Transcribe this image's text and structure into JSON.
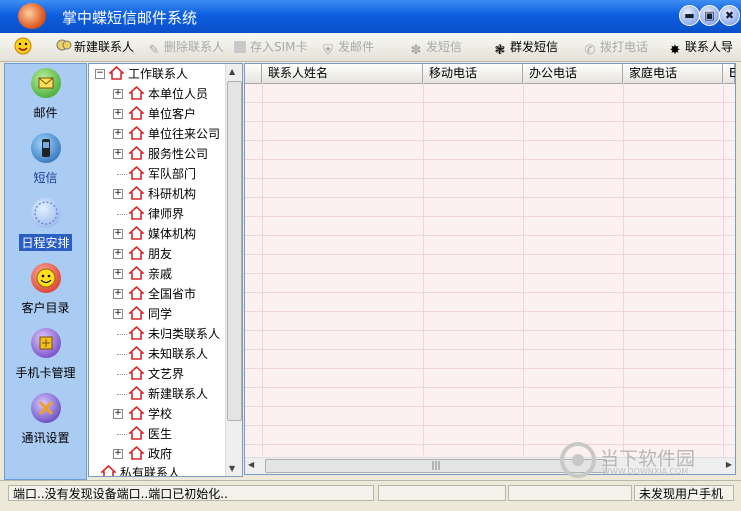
{
  "window": {
    "title": "掌中蝶短信邮件系统"
  },
  "title_buttons": {
    "minimize": "▬",
    "restore": "▣",
    "close": "✖"
  },
  "toolbar": {
    "new_contact": "新建联系人",
    "delete_contact": "删除联系人",
    "save_sim": "存入SIM卡",
    "send_mail": "发邮件",
    "send_sms": "发短信",
    "bulk_sms": "群发短信",
    "dial": "拨打电话",
    "contact_group": "联系人导"
  },
  "sidebar": {
    "items": [
      {
        "label": "邮件",
        "icon": "mail-icon",
        "selected": false
      },
      {
        "label": "短信",
        "icon": "phone-icon",
        "selected": false
      },
      {
        "label": "日程安排",
        "icon": "schedule-icon",
        "selected": true
      },
      {
        "label": "客户目录",
        "icon": "smiley-icon",
        "selected": false
      },
      {
        "label": "手机卡管理",
        "icon": "simcard-icon",
        "selected": false
      },
      {
        "label": "通讯设置",
        "icon": "tools-icon",
        "selected": false
      }
    ]
  },
  "tree": {
    "root": "工作联系人",
    "items": [
      {
        "label": "本单位人员",
        "expandable": true
      },
      {
        "label": "单位客户",
        "expandable": true
      },
      {
        "label": "单位往来公司",
        "expandable": true
      },
      {
        "label": "服务性公司",
        "expandable": true
      },
      {
        "label": "军队部门",
        "expandable": false
      },
      {
        "label": "科研机构",
        "expandable": true
      },
      {
        "label": "律师界",
        "expandable": false
      },
      {
        "label": "媒体机构",
        "expandable": true
      },
      {
        "label": "朋友",
        "expandable": true
      },
      {
        "label": "亲戚",
        "expandable": true
      },
      {
        "label": "全国省市",
        "expandable": true
      },
      {
        "label": "同学",
        "expandable": true
      },
      {
        "label": "未归类联系人",
        "expandable": false
      },
      {
        "label": "未知联系人",
        "expandable": false
      },
      {
        "label": "文艺界",
        "expandable": false
      },
      {
        "label": "新建联系人",
        "expandable": false
      },
      {
        "label": "学校",
        "expandable": true
      },
      {
        "label": "医生",
        "expandable": false
      },
      {
        "label": "政府",
        "expandable": true
      }
    ],
    "second_root": "私有联系人"
  },
  "grid": {
    "columns": [
      "联系人姓名",
      "移动电话",
      "办公电话",
      "家庭电话",
      "E"
    ]
  },
  "status": {
    "port_message": "端口..没有发现设备端口..端口已初始化..",
    "user_message": "未发现用户手机"
  },
  "watermark": {
    "text": "当下软件园",
    "sub": "WWW.DOWNXIA.COM"
  },
  "colors": {
    "accent": "#0d5ee0",
    "sidebar_bg": "#aaccf2",
    "grid_bg": "#fdf0f0",
    "house": "#d8262a"
  }
}
